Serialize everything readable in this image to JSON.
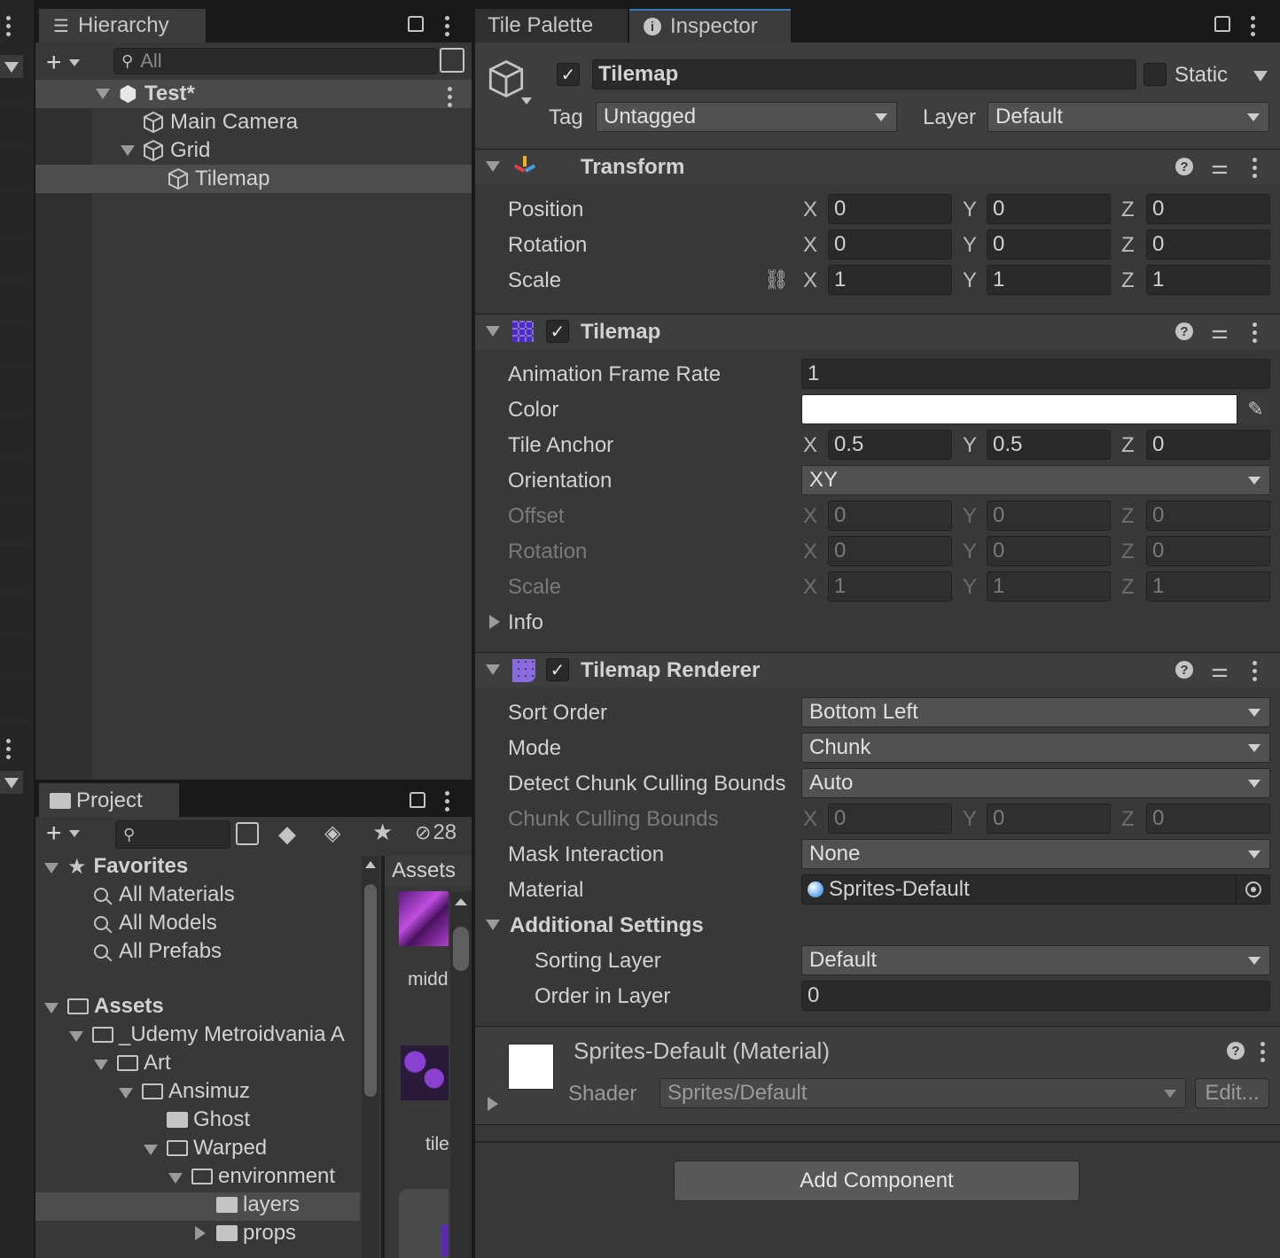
{
  "hierarchy": {
    "tab_label": "Hierarchy",
    "search_placeholder": "All",
    "items": [
      {
        "label": "Test*"
      },
      {
        "label": "Main Camera"
      },
      {
        "label": "Grid"
      },
      {
        "label": "Tilemap"
      }
    ]
  },
  "project": {
    "tab_label": "Project",
    "hidden_count": "28",
    "assets_tab": "Assets",
    "favorites": {
      "label": "Favorites",
      "items": [
        "All Materials",
        "All Models",
        "All Prefabs"
      ]
    },
    "tree": [
      {
        "label": "Assets"
      },
      {
        "label": "_Udemy Metroidvania A"
      },
      {
        "label": "Art"
      },
      {
        "label": "Ansimuz"
      },
      {
        "label": "Ghost"
      },
      {
        "label": "Warped"
      },
      {
        "label": "environment"
      },
      {
        "label": "layers"
      },
      {
        "label": "props"
      }
    ],
    "thumbnails": [
      {
        "label": "midd"
      },
      {
        "label": "tile"
      }
    ]
  },
  "inspector_tabs": {
    "tile_palette": "Tile Palette",
    "inspector": "Inspector"
  },
  "object": {
    "name": "Tilemap",
    "static_label": "Static",
    "tag_label": "Tag",
    "tag_value": "Untagged",
    "layer_label": "Layer",
    "layer_value": "Default"
  },
  "transform": {
    "title": "Transform",
    "rows": [
      {
        "label": "Position",
        "x": "0",
        "y": "0",
        "z": "0"
      },
      {
        "label": "Rotation",
        "x": "0",
        "y": "0",
        "z": "0"
      },
      {
        "label": "Scale",
        "x": "1",
        "y": "1",
        "z": "1"
      }
    ]
  },
  "axes": {
    "x": "X",
    "y": "Y",
    "z": "Z"
  },
  "tilemap": {
    "title": "Tilemap",
    "animation_frame_rate_label": "Animation Frame Rate",
    "animation_frame_rate": "1",
    "color_label": "Color",
    "color_value": "#ffffff",
    "tile_anchor_label": "Tile Anchor",
    "tile_anchor": {
      "x": "0.5",
      "y": "0.5",
      "z": "0"
    },
    "orientation_label": "Orientation",
    "orientation": "XY",
    "offset_label": "Offset",
    "offset": {
      "x": "0",
      "y": "0",
      "z": "0"
    },
    "rotation_label": "Rotation",
    "rotation": {
      "x": "0",
      "y": "0",
      "z": "0"
    },
    "scale_label": "Scale",
    "scale": {
      "x": "1",
      "y": "1",
      "z": "1"
    },
    "info_label": "Info"
  },
  "renderer": {
    "title": "Tilemap Renderer",
    "sort_order_label": "Sort Order",
    "sort_order": "Bottom Left",
    "mode_label": "Mode",
    "mode": "Chunk",
    "detect_label": "Detect Chunk Culling Bounds",
    "detect": "Auto",
    "chunk_bounds_label": "Chunk Culling Bounds",
    "chunk_bounds": {
      "x": "0",
      "y": "0",
      "z": "0"
    },
    "mask_label": "Mask Interaction",
    "mask": "None",
    "material_label": "Material",
    "material": "Sprites-Default",
    "additional_label": "Additional Settings",
    "sorting_layer_label": "Sorting Layer",
    "sorting_layer": "Default",
    "order_label": "Order in Layer",
    "order": "0"
  },
  "material_section": {
    "title": "Sprites-Default (Material)",
    "shader_label": "Shader",
    "shader": "Sprites/Default",
    "edit_label": "Edit..."
  },
  "add_component_label": "Add Component",
  "colors": {
    "accent": "#3a79bb",
    "panel": "#383838",
    "field": "#2a2a2a"
  }
}
